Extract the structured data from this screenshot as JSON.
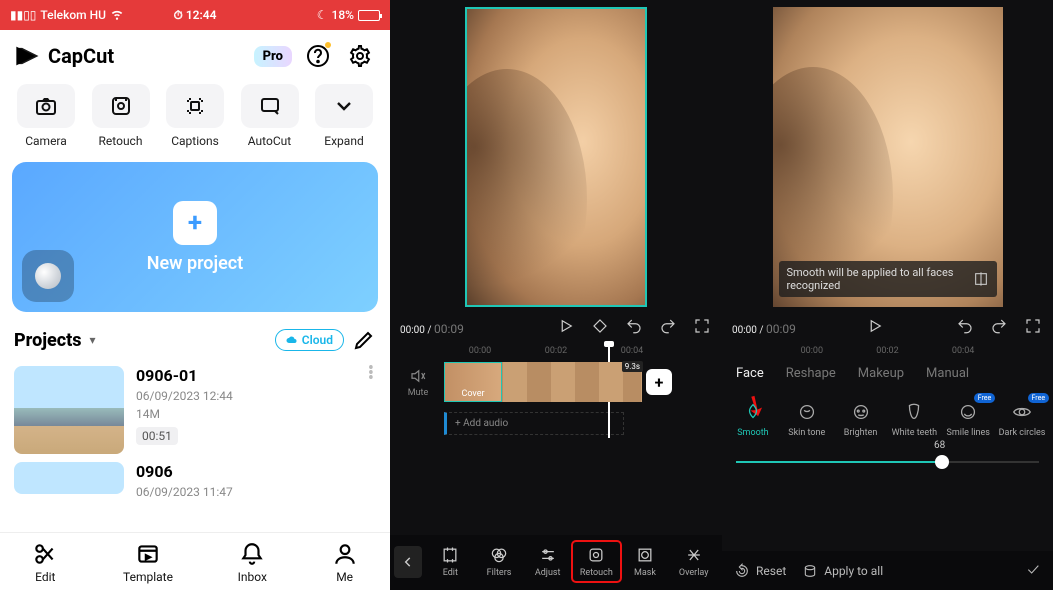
{
  "panel1": {
    "statusbar": {
      "carrier": "Telekom HU",
      "time": "12:44",
      "battery_pct": "18%"
    },
    "app_name": "CapCut",
    "pro_label": "Pro",
    "tools": [
      {
        "key": "camera",
        "label": "Camera"
      },
      {
        "key": "retouch",
        "label": "Retouch"
      },
      {
        "key": "captions",
        "label": "Captions"
      },
      {
        "key": "autocut",
        "label": "AutoCut"
      },
      {
        "key": "expand",
        "label": "Expand"
      }
    ],
    "new_project_label": "New project",
    "projects_heading": "Projects",
    "cloud_label": "Cloud",
    "projects": [
      {
        "name": "0906-01",
        "meta": "06/09/2023 12:44",
        "size": "14M",
        "duration": "00:51"
      },
      {
        "name": "0906",
        "meta": "06/09/2023 11:47"
      }
    ],
    "bottom_nav": [
      {
        "key": "edit",
        "label": "Edit"
      },
      {
        "key": "template",
        "label": "Template"
      },
      {
        "key": "inbox",
        "label": "Inbox"
      },
      {
        "key": "me",
        "label": "Me"
      }
    ]
  },
  "panel2": {
    "cur_time": "00:00",
    "total_time": "00:09",
    "ruler": [
      "00:00",
      "00:02",
      "00:04"
    ],
    "mute_label": "Mute",
    "cover_label": "Cover",
    "clip_tag": "9.3s",
    "add_audio": "+  Add audio",
    "tools": [
      {
        "key": "edit",
        "label": "Edit"
      },
      {
        "key": "filters",
        "label": "Filters"
      },
      {
        "key": "adjust",
        "label": "Adjust"
      },
      {
        "key": "retouch",
        "label": "Retouch",
        "selected": true
      },
      {
        "key": "mask",
        "label": "Mask"
      },
      {
        "key": "overlay",
        "label": "Overlay"
      }
    ]
  },
  "panel3": {
    "cur_time": "00:00",
    "total_time": "00:09",
    "ruler": [
      "00:00",
      "00:02",
      "00:04"
    ],
    "toast": "Smooth will be applied to all faces recognized",
    "tabs": [
      {
        "key": "face",
        "label": "Face",
        "active": true
      },
      {
        "key": "reshape",
        "label": "Reshape"
      },
      {
        "key": "makeup",
        "label": "Makeup"
      },
      {
        "key": "manual",
        "label": "Manual"
      }
    ],
    "items": [
      {
        "key": "smooth",
        "label": "Smooth",
        "active": true
      },
      {
        "key": "skintone",
        "label": "Skin tone"
      },
      {
        "key": "brighten",
        "label": "Brighten"
      },
      {
        "key": "whiteteeth",
        "label": "White teeth"
      },
      {
        "key": "smilelines",
        "label": "Smile lines",
        "badge": "Free"
      },
      {
        "key": "darkcircles",
        "label": "Dark circles",
        "badge": "Free"
      }
    ],
    "slider_value": "68",
    "reset_label": "Reset",
    "apply_all_label": "Apply to all"
  }
}
